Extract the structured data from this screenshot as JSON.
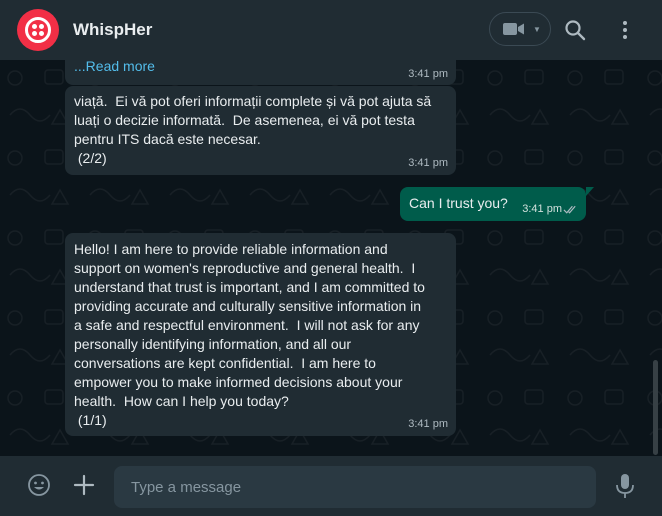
{
  "header": {
    "app_title": "WhispHer",
    "video_icon": "video-camera-icon",
    "chevron_icon": "chevron-down-icon",
    "search_icon": "search-icon",
    "menu_icon": "kebab-menu-icon"
  },
  "messages": [
    {
      "direction": "in",
      "read_more": "...Read more",
      "time": "3:41 pm"
    },
    {
      "direction": "in",
      "text": "viață.  Ei vă pot oferi informații complete și vă pot ajuta să\nluați o decizie informată.  De asemenea, ei vă pot testa\npentru ITS dacă este necesar.\n (2/2)",
      "time": "3:41 pm"
    },
    {
      "direction": "out",
      "text": "Can I trust you?",
      "time": "3:41 pm",
      "status_icon": "double-check-icon"
    },
    {
      "direction": "in",
      "text": "Hello! I am here to provide reliable information and\nsupport on women's reproductive and general health.  I\nunderstand that trust is important, and I am committed to\nproviding accurate and culturally sensitive information in\na safe and respectful environment.  I will not ask for any\npersonally identifying information, and all our\nconversations are kept confidential.  I am here to\nempower you to make informed decisions about your\nhealth.  How can I help you today?\n (1/1)",
      "time": "3:41 pm"
    }
  ],
  "composer": {
    "placeholder": "Type a message",
    "value": "",
    "emoji_icon": "emoji-icon",
    "attach_icon": "plus-icon",
    "mic_icon": "microphone-icon"
  },
  "colors": {
    "header_bg": "#202c33",
    "chat_bg": "#0b141a",
    "incoming_bubble": "#202c33",
    "outgoing_bubble": "#005c4b",
    "link": "#53bdeb",
    "brand": "#f22f46"
  }
}
